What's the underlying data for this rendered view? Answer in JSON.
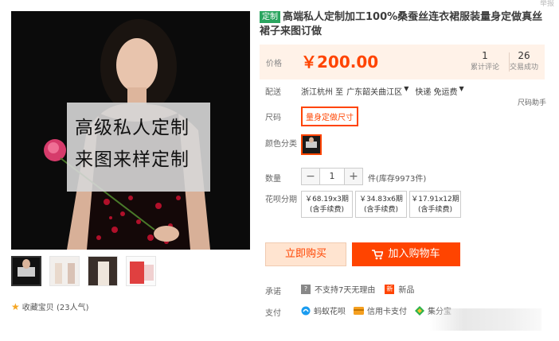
{
  "corner_mark": "举报",
  "gallery": {
    "overlay_lines": [
      "高级私人定制",
      "来图来样定制"
    ],
    "thumbnail_count": 4
  },
  "favorite": {
    "label": "收藏宝贝 (23人气)"
  },
  "product": {
    "tag": "定制",
    "title": "高端私人定制加工100%桑蚕丝连衣裙服装量身定做真丝裙子来图订做"
  },
  "price": {
    "label": "价格",
    "value": "￥200.00",
    "stats": [
      {
        "num": "1",
        "label": "累计评论"
      },
      {
        "num": "26",
        "label": "交易成功"
      }
    ]
  },
  "delivery": {
    "label": "配送",
    "origin": "浙江杭州 至",
    "destination": "广东韶关曲江区",
    "express": "快递 免运费"
  },
  "size": {
    "label": "尺码",
    "option": "量身定做尺寸",
    "guide": "尺码助手"
  },
  "color": {
    "label": "颜色分类"
  },
  "quantity": {
    "label": "数量",
    "value": "1",
    "minus": "−",
    "plus": "+",
    "stock": "件(库存9973件)"
  },
  "installment": {
    "label": "花呗分期",
    "options": [
      {
        "amount": "￥68.19x3期",
        "note": "(含手续费)"
      },
      {
        "amount": "￥34.83x6期",
        "note": "(含手续费)"
      },
      {
        "amount": "￥17.91x12期",
        "note": "(含手续费)"
      }
    ]
  },
  "buttons": {
    "buy": "立即购买",
    "cart": "加入购物车"
  },
  "promise": {
    "label": "承诺",
    "no_return": "不支持7天无理由",
    "new": "新品"
  },
  "payment": {
    "label": "支付",
    "methods": [
      "蚂蚁花呗",
      "信用卡支付",
      "集分宝"
    ]
  },
  "colors": {
    "accent": "#ff4400",
    "price_bg": "#fff2e8",
    "tag_green": "#2aa55f"
  }
}
